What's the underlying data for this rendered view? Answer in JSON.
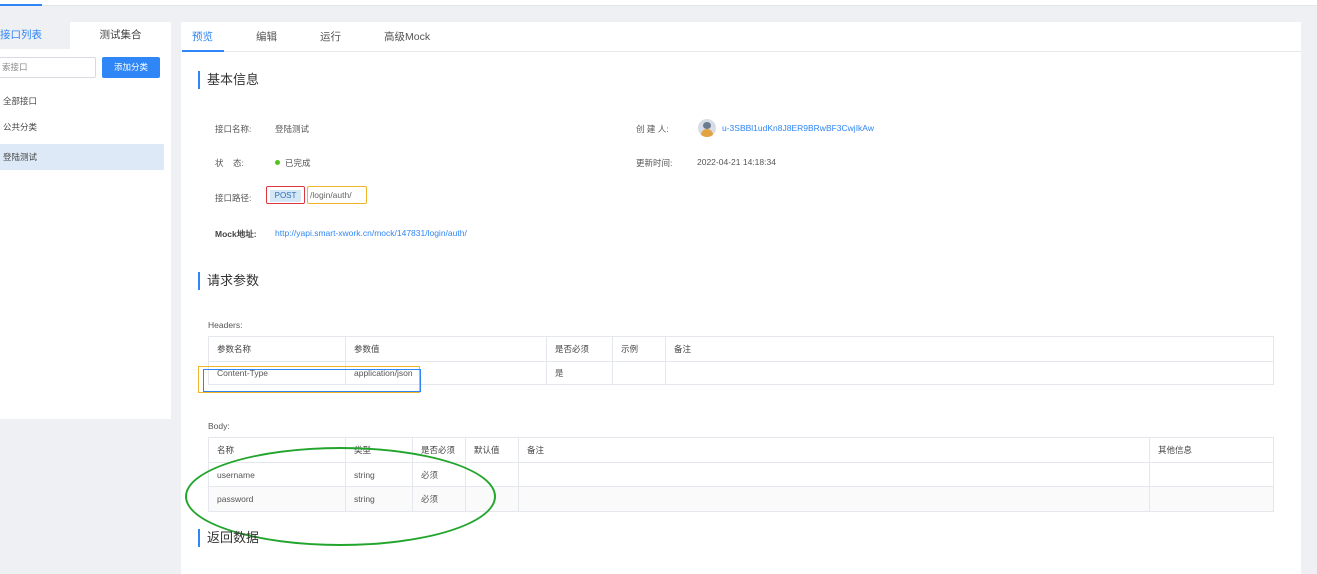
{
  "sidebar": {
    "tab_list": "接口列表",
    "tab_collection": "测试集合",
    "search_placeholder": "索接口",
    "add_category": "添加分类",
    "items": [
      "全部接口",
      "公共分类",
      "登陆测试"
    ]
  },
  "tabs": [
    "预览",
    "编辑",
    "运行",
    "高级Mock"
  ],
  "basic": {
    "title": "基本信息",
    "name_label": "接口名称:",
    "name_value": "登陆测试",
    "creator_label": "创 建 人:",
    "creator_value": "u-3SBBl1udKn8J8ER9BRwBF3CwjIkAw",
    "status_label": "状    态:",
    "status_value": "已完成",
    "updated_label": "更新时间:",
    "updated_value": "2022-04-21 14:18:34",
    "path_label": "接口路径:",
    "method": "POST",
    "path": "/login/auth/",
    "mock_label": "Mock地址:",
    "mock_url": "http://yapi.smart-xwork.cn/mock/147831/login/auth/"
  },
  "request": {
    "title": "请求参数",
    "headers_label": "Headers:",
    "headers_columns": [
      "参数名称",
      "参数值",
      "是否必须",
      "示例",
      "备注"
    ],
    "headers_rows": [
      [
        "Content-Type",
        "application/json",
        "是",
        "",
        ""
      ]
    ],
    "body_label": "Body:",
    "body_columns": [
      "名称",
      "类型",
      "是否必须",
      "默认值",
      "备注",
      "其他信息"
    ],
    "body_rows": [
      [
        "username",
        "string",
        "必须",
        "",
        "",
        ""
      ],
      [
        "password",
        "string",
        "必须",
        "",
        "",
        ""
      ]
    ]
  },
  "response": {
    "title": "返回数据"
  },
  "colors": {
    "accent": "#2f86f6",
    "status_done": "#52c41a",
    "method_box_border": "#d9363e",
    "path_box_border": "#f0b429",
    "annotation_green": "#22a52c"
  }
}
